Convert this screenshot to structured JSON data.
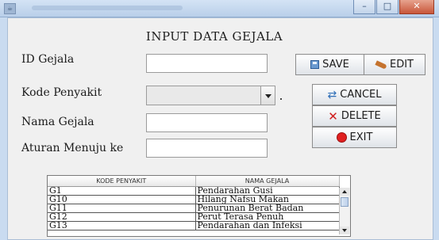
{
  "window": {
    "minimize": "–",
    "maximize": "□",
    "close": "✕"
  },
  "form": {
    "title": "INPUT DATA GEJALA",
    "labels": {
      "id_gejala": "ID Gejala",
      "kode_penyakit": "Kode Penyakit",
      "nama_gejala": "Nama Gejala",
      "aturan": "Aturan Menuju ke"
    },
    "values": {
      "id_gejala": "",
      "kode_penyakit": "",
      "nama_gejala": "",
      "aturan": ""
    }
  },
  "buttons": {
    "save": "SAVE",
    "edit": "EDIT",
    "cancel": "CANCEL",
    "delete": "DELETE",
    "exit": "EXIT"
  },
  "icons": {
    "save": "save-icon",
    "edit": "edit-icon",
    "cancel": "refresh-icon",
    "delete": "x-icon",
    "exit": "red-circle-icon"
  },
  "table": {
    "columns": [
      "KODE PENYAKIT",
      "NAMA GEJALA"
    ],
    "rows": [
      [
        "G1",
        "Pendarahan Gusi"
      ],
      [
        "G10",
        "Hilang Nafsu Makan"
      ],
      [
        "G11",
        "Penurunan Berat Badan"
      ],
      [
        "G12",
        "Perut Terasa Penuh"
      ],
      [
        "G13",
        "Pendarahan dan Infeksi"
      ]
    ]
  },
  "colors": {
    "window_frame": "#c9dbf0",
    "panel": "#f0f0f0",
    "delete_icon": "#d01e1e",
    "cancel_icon": "#2f6fb8"
  }
}
